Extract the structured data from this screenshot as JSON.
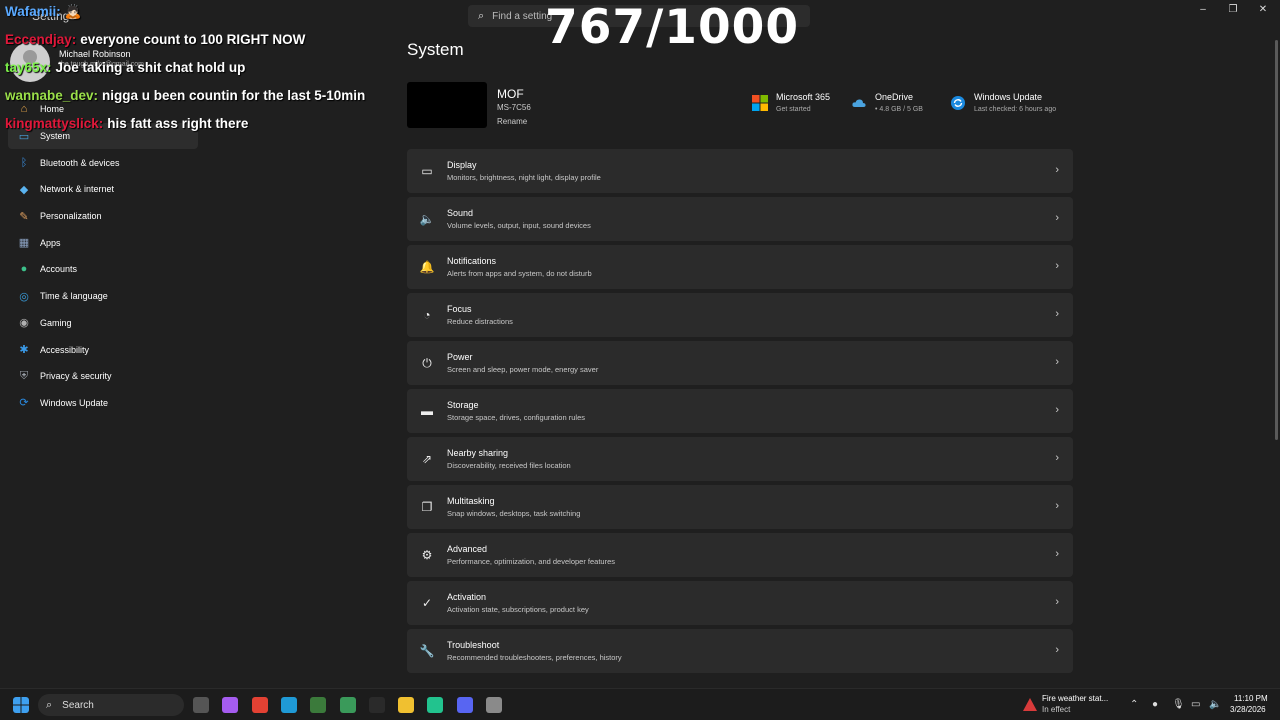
{
  "window": {
    "title": "Settings",
    "search_placeholder": "Find a setting",
    "controls": [
      "–",
      "❐",
      "✕"
    ]
  },
  "user": {
    "name": "Michael Robinson",
    "email": "the.tough.mike@gmail.com"
  },
  "sidebar": {
    "items": [
      {
        "label": "Home",
        "icon": "home-icon"
      },
      {
        "label": "System",
        "icon": "monitor-icon",
        "active": true
      },
      {
        "label": "Bluetooth & devices",
        "icon": "bluetooth-icon"
      },
      {
        "label": "Network & internet",
        "icon": "wifi-icon"
      },
      {
        "label": "Personalization",
        "icon": "brush-icon"
      },
      {
        "label": "Apps",
        "icon": "apps-icon"
      },
      {
        "label": "Accounts",
        "icon": "person-icon"
      },
      {
        "label": "Time & language",
        "icon": "globe-icon"
      },
      {
        "label": "Gaming",
        "icon": "controller-icon"
      },
      {
        "label": "Accessibility",
        "icon": "accessibility-icon"
      },
      {
        "label": "Privacy & security",
        "icon": "shield-icon"
      },
      {
        "label": "Windows Update",
        "icon": "update-icon"
      }
    ]
  },
  "main": {
    "title": "System",
    "device": {
      "name": "MOF",
      "model": "MS-7C56",
      "rename": "Rename"
    },
    "quick": [
      {
        "title": "Microsoft 365",
        "sub": "Get started",
        "icon": "microsoft-icon"
      },
      {
        "title": "OneDrive",
        "sub": "• 4.8 GB / 5 GB",
        "icon": "cloud-icon"
      },
      {
        "title": "Windows Update",
        "sub": "Last checked: 6 hours ago",
        "icon": "update-icon"
      }
    ],
    "cards": [
      {
        "title": "Display",
        "sub": "Monitors, brightness, night light, display profile",
        "icon": "display-icon"
      },
      {
        "title": "Sound",
        "sub": "Volume levels, output, input, sound devices",
        "icon": "speaker-icon"
      },
      {
        "title": "Notifications",
        "sub": "Alerts from apps and system, do not disturb",
        "icon": "bell-icon"
      },
      {
        "title": "Focus",
        "sub": "Reduce distractions",
        "icon": "focus-icon"
      },
      {
        "title": "Power",
        "sub": "Screen and sleep, power mode, energy saver",
        "icon": "power-icon"
      },
      {
        "title": "Storage",
        "sub": "Storage space, drives, configuration rules",
        "icon": "storage-icon"
      },
      {
        "title": "Nearby sharing",
        "sub": "Discoverability, received files location",
        "icon": "share-icon"
      },
      {
        "title": "Multitasking",
        "sub": "Snap windows, desktops, task switching",
        "icon": "multitask-icon"
      },
      {
        "title": "Advanced",
        "sub": "Performance, optimization, and developer features",
        "icon": "advanced-icon"
      },
      {
        "title": "Activation",
        "sub": "Activation state, subscriptions, product key",
        "icon": "check-icon"
      },
      {
        "title": "Troubleshoot",
        "sub": "Recommended troubleshooters, preferences, history",
        "icon": "wrench-icon"
      }
    ]
  },
  "overlay": {
    "counter": "767/1000",
    "chat": [
      {
        "user": "Wafamii:",
        "message": "🙇🏻",
        "user_color": "#5aa9ff"
      },
      {
        "user": "Eccendjay:",
        "message": "everyone count to 100 RIGHT NOW",
        "user_color": "#e0183a"
      },
      {
        "user": "tay65x:",
        "message": "Joe taking a shit chat hold up",
        "user_color": "#7cf04a"
      },
      {
        "user": "wannabe_dev:",
        "message": "nigga u been countin for the last 5-10min",
        "user_color": "#9be04a"
      },
      {
        "user": "kingmattyslick:",
        "message": "his fatt ass right there",
        "user_color": "#e0183a"
      }
    ]
  },
  "taskbar": {
    "search_label": "Search",
    "weather_title": "Fire weather stat...",
    "weather_sub": "In effect",
    "time": "11:10 PM",
    "date": "3/28/2026",
    "apps": [
      {
        "icon": "task-view-icon",
        "color": "#555555"
      },
      {
        "icon": "copilot-icon",
        "color": "#a55cf0"
      },
      {
        "icon": "chrome-icon",
        "color": "#e34133"
      },
      {
        "icon": "edge-icon",
        "color": "#1f9ad6"
      },
      {
        "icon": "game-icon",
        "color": "#3b7a3b"
      },
      {
        "icon": "store-icon",
        "color": "#3a9a5a"
      },
      {
        "icon": "obs-icon",
        "color": "#2a2a2a"
      },
      {
        "icon": "explorer-icon",
        "color": "#f0c030"
      },
      {
        "icon": "app-green-icon",
        "color": "#22c38e"
      },
      {
        "icon": "discord-icon",
        "color": "#5865f2"
      },
      {
        "icon": "settings-icon",
        "color": "#8a8a8a"
      }
    ]
  }
}
